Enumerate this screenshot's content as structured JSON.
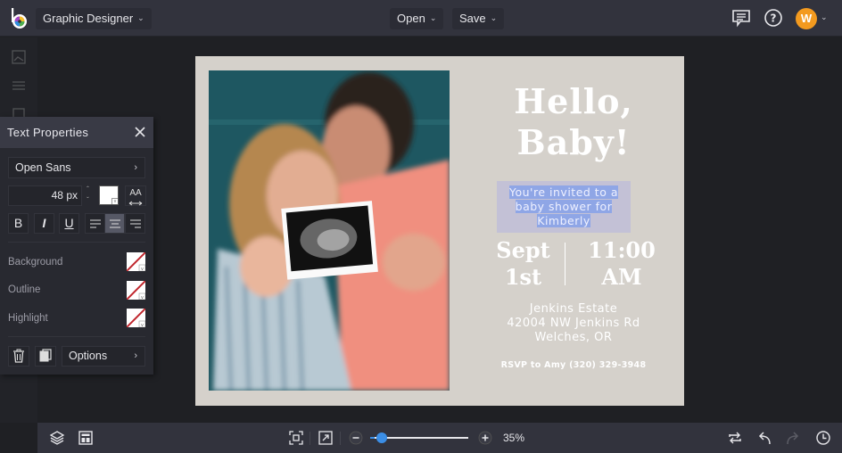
{
  "app": {
    "workspace_label": "Graphic Designer",
    "open_label": "Open",
    "save_label": "Save",
    "user_initial": "W",
    "accent_color": "#f39a1f"
  },
  "text_properties": {
    "title": "Text Properties",
    "font_family": "Open Sans",
    "font_size": "48",
    "font_size_unit": "px",
    "text_color": "#ffffff",
    "case_label": "AA",
    "bold_label": "B",
    "italic_label": "I",
    "underline_label": "U",
    "alignment": "center",
    "background_label": "Background",
    "outline_label": "Outline",
    "highlight_label": "Highlight",
    "options_label": "Options"
  },
  "design": {
    "headline_line1": "Hello,",
    "headline_line2": "Baby!",
    "invite_line1": "You're invited to a",
    "invite_line2": "baby shower for",
    "invite_line3": "Kimberly",
    "date_line1": "Sept",
    "date_line2": "1st",
    "time_line1": "11:00",
    "time_line2": "AM",
    "venue_line1": "Jenkins Estate",
    "venue_line2": "42004 NW Jenkins Rd",
    "venue_line3": "Welches, OR",
    "rsvp": "RSVP to Amy (320) 329-3948",
    "background_color": "#d5d1cb"
  },
  "bottom_bar": {
    "zoom_percent": 35,
    "zoom_label": "35%"
  }
}
